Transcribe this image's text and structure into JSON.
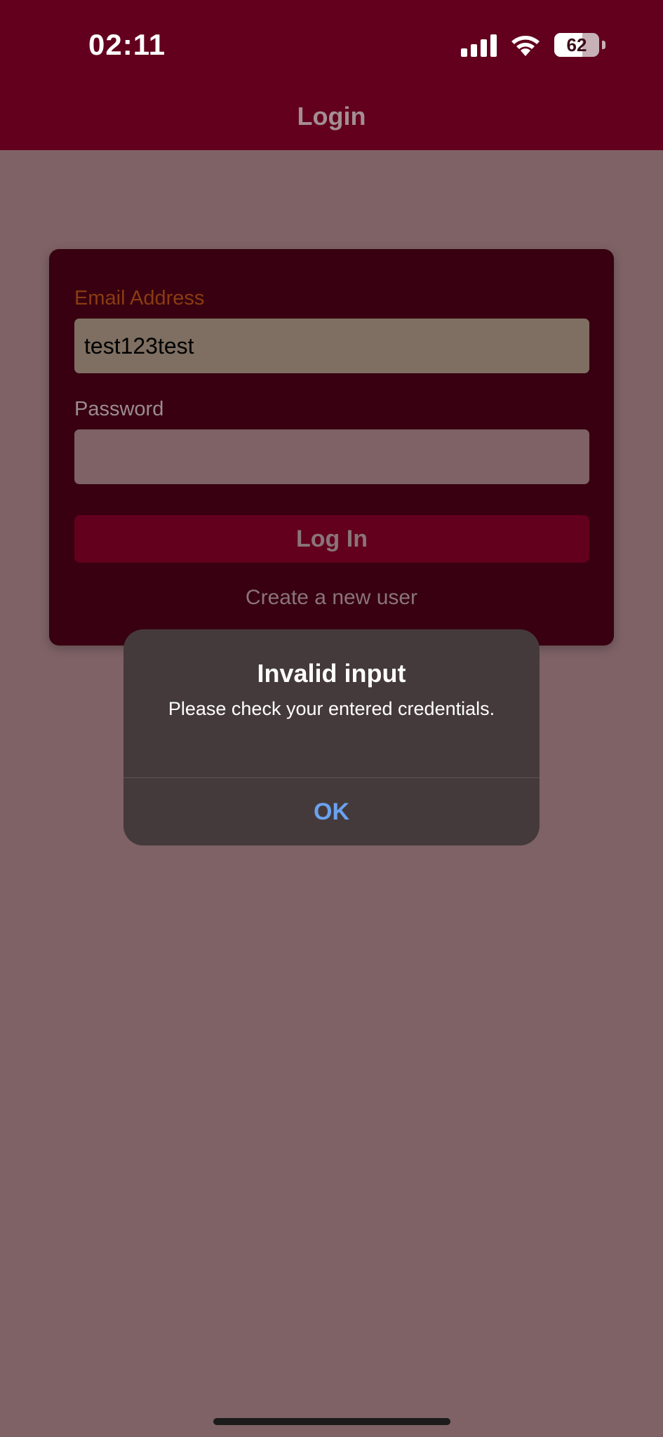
{
  "status_bar": {
    "time": "02:11",
    "battery_level": "62",
    "icons": [
      "cellular-signal-icon",
      "wifi-icon",
      "battery-icon"
    ]
  },
  "header": {
    "title": "Login"
  },
  "form": {
    "email_label": "Email Address",
    "email_value": "test123test",
    "password_label": "Password",
    "password_value": "",
    "login_button": "Log In",
    "create_user_link": "Create a new user"
  },
  "alert": {
    "title": "Invalid input",
    "message": "Please check your entered credentials.",
    "ok_button": "OK"
  },
  "colors": {
    "header_bg": "#62001d",
    "card_bg": "#380010",
    "alert_bg": "#453a3b",
    "alert_ok": "#6aa2f0"
  }
}
